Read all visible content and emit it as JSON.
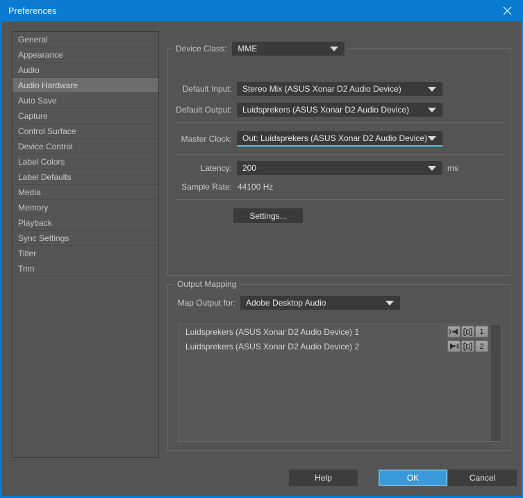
{
  "window": {
    "title": "Preferences",
    "close_icon": "close-icon",
    "accent_color": "#0b7ad1"
  },
  "sidebar": {
    "items": [
      {
        "label": "General",
        "selected": false
      },
      {
        "label": "Appearance",
        "selected": false
      },
      {
        "label": "Audio",
        "selected": false
      },
      {
        "label": "Audio Hardware",
        "selected": true
      },
      {
        "label": "Auto Save",
        "selected": false
      },
      {
        "label": "Capture",
        "selected": false
      },
      {
        "label": "Control Surface",
        "selected": false
      },
      {
        "label": "Device Control",
        "selected": false
      },
      {
        "label": "Label Colors",
        "selected": false
      },
      {
        "label": "Label Defaults",
        "selected": false
      },
      {
        "label": "Media",
        "selected": false
      },
      {
        "label": "Memory",
        "selected": false
      },
      {
        "label": "Playback",
        "selected": false
      },
      {
        "label": "Sync Settings",
        "selected": false
      },
      {
        "label": "Titler",
        "selected": false
      },
      {
        "label": "Trim",
        "selected": false
      }
    ]
  },
  "device_group": {
    "device_class_label": "Device Class:",
    "device_class_value": "MME",
    "default_input_label": "Default Input:",
    "default_input_value": "Stereo Mix (ASUS Xonar D2 Audio Device)",
    "default_output_label": "Default Output:",
    "default_output_value": "Luidsprekers (ASUS Xonar D2 Audio Device)",
    "master_clock_label": "Master Clock:",
    "master_clock_value": "Out: Luidsprekers (ASUS Xonar D2 Audio Device)",
    "master_clock_focus_color": "#3ec9e8",
    "latency_label": "Latency:",
    "latency_value": "200",
    "latency_unit": "ms",
    "sample_rate_label": "Sample Rate:",
    "sample_rate_value": "44100 Hz",
    "settings_button": "Settings..."
  },
  "output_mapping": {
    "legend": "Output Mapping",
    "map_output_label": "Map Output for:",
    "map_output_value": "Adobe Desktop Audio",
    "rows": [
      {
        "label": "Luidsprekers (ASUS Xonar D2 Audio Device) 1",
        "pan_icon": "speaker-left-icon",
        "assign_icon": "channel-frame-icon",
        "channel": "1"
      },
      {
        "label": "Luidsprekers (ASUS Xonar D2 Audio Device) 2",
        "pan_icon": "speaker-right-icon",
        "assign_icon": "channel-frame-icon",
        "channel": "2"
      }
    ]
  },
  "footer": {
    "help_label": "Help",
    "ok_label": "OK",
    "cancel_label": "Cancel",
    "ok_color": "#3a9ad9"
  }
}
